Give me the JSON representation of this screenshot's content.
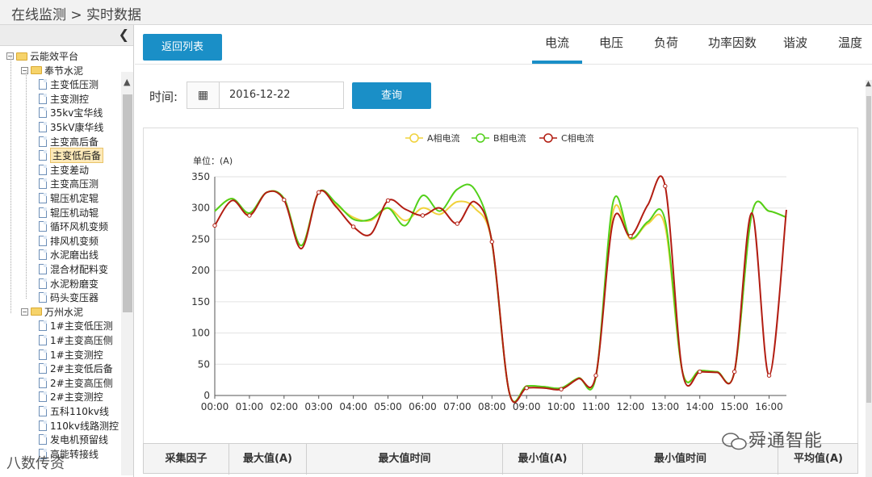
{
  "breadcrumb": "在线监测 > 实时数据",
  "sidebar": {
    "collapse_icon": "chevron-left-icon",
    "tree": [
      {
        "label": "云能效平台",
        "kind": "folder",
        "level": 0,
        "toggle": "⊟"
      },
      {
        "label": "奉节水泥",
        "kind": "folder",
        "level": 1,
        "toggle": "⊟"
      },
      {
        "label": "主变低压测",
        "kind": "doc",
        "level": 2
      },
      {
        "label": "主变测控",
        "kind": "doc",
        "level": 2
      },
      {
        "label": "35kv宝华线",
        "kind": "doc",
        "level": 2
      },
      {
        "label": "35kV康华线",
        "kind": "doc",
        "level": 2
      },
      {
        "label": "主变高后备",
        "kind": "doc",
        "level": 2
      },
      {
        "label": "主变低后备",
        "kind": "doc",
        "level": 2,
        "selected": true
      },
      {
        "label": "主变差动",
        "kind": "doc",
        "level": 2
      },
      {
        "label": "主变高压测",
        "kind": "doc",
        "level": 2
      },
      {
        "label": "辊压机定辊",
        "kind": "doc",
        "level": 2
      },
      {
        "label": "辊压机动辊",
        "kind": "doc",
        "level": 2
      },
      {
        "label": "循环风机变频",
        "kind": "doc",
        "level": 2
      },
      {
        "label": "排风机变频",
        "kind": "doc",
        "level": 2
      },
      {
        "label": "水泥磨出线",
        "kind": "doc",
        "level": 2
      },
      {
        "label": "混合材配料变",
        "kind": "doc",
        "level": 2
      },
      {
        "label": "水泥粉磨变",
        "kind": "doc",
        "level": 2
      },
      {
        "label": "码头变压器",
        "kind": "doc",
        "level": 2
      },
      {
        "label": "万州水泥",
        "kind": "folder",
        "level": 1,
        "toggle": "⊟"
      },
      {
        "label": "1#主变低压测",
        "kind": "doc",
        "level": 2
      },
      {
        "label": "1#主变高压侧",
        "kind": "doc",
        "level": 2
      },
      {
        "label": "1#主变测控",
        "kind": "doc",
        "level": 2
      },
      {
        "label": "2#主变低后备",
        "kind": "doc",
        "level": 2
      },
      {
        "label": "2#主变高压侧",
        "kind": "doc",
        "level": 2
      },
      {
        "label": "2#主变测控",
        "kind": "doc",
        "level": 2
      },
      {
        "label": "五科110kv线",
        "kind": "doc",
        "level": 2
      },
      {
        "label": "110kv线路测控",
        "kind": "doc",
        "level": 2
      },
      {
        "label": "发电机预留线",
        "kind": "doc",
        "level": 2
      },
      {
        "label": "高能转接线",
        "kind": "doc",
        "level": 2
      }
    ]
  },
  "toolbar": {
    "back_label": "返回列表"
  },
  "tabs": [
    "电流",
    "电压",
    "负荷",
    "功率因数",
    "谐波",
    "温度"
  ],
  "active_tab": 0,
  "query": {
    "time_label": "时间:",
    "date_value": "2016-12-22",
    "calendar_icon": "calendar-icon",
    "query_label": "查询"
  },
  "chart_data": {
    "type": "line",
    "unit_label": "单位：(A)",
    "x": [
      "00:00",
      "00:30",
      "01:00",
      "01:30",
      "02:00",
      "02:30",
      "03:00",
      "03:30",
      "04:00",
      "04:30",
      "05:00",
      "05:30",
      "06:00",
      "06:30",
      "07:00",
      "07:30",
      "08:00",
      "08:30",
      "09:00",
      "09:30",
      "10:00",
      "10:30",
      "11:00",
      "11:30",
      "12:00",
      "12:30",
      "13:00",
      "13:30",
      "14:00",
      "14:30",
      "15:00",
      "15:30",
      "16:00",
      "16:30"
    ],
    "x_ticks": [
      "00:00",
      "01:00",
      "02:00",
      "03:00",
      "04:00",
      "05:00",
      "06:00",
      "07:00",
      "08:00",
      "09:00",
      "10:00",
      "11:00",
      "12:00",
      "13:00",
      "14:00",
      "15:00",
      "16:00"
    ],
    "ylim": [
      0,
      350
    ],
    "y_ticks": [
      0,
      50,
      100,
      150,
      200,
      250,
      300,
      350
    ],
    "grid": true,
    "legend_position": "top-center",
    "series": [
      {
        "name": "A相电流",
        "color": "#f0d23c",
        "values": [
          295,
          315,
          290,
          325,
          315,
          240,
          325,
          305,
          285,
          280,
          300,
          280,
          300,
          290,
          310,
          300,
          245,
          5,
          15,
          14,
          12,
          28,
          30,
          295,
          250,
          275,
          270,
          38,
          40,
          38,
          38,
          290,
          295,
          285
        ]
      },
      {
        "name": "B相电流",
        "color": "#52d01a",
        "values": [
          295,
          315,
          292,
          325,
          315,
          240,
          325,
          308,
          282,
          282,
          300,
          272,
          320,
          295,
          330,
          330,
          245,
          5,
          15,
          14,
          12,
          28,
          30,
          310,
          252,
          278,
          280,
          38,
          40,
          38,
          38,
          290,
          295,
          285
        ]
      },
      {
        "name": "C相电流",
        "color": "#b21d12",
        "values": [
          272,
          312,
          288,
          325,
          313,
          235,
          325,
          302,
          270,
          258,
          312,
          298,
          288,
          300,
          275,
          310,
          246,
          5,
          12,
          12,
          10,
          27,
          32,
          280,
          255,
          305,
          335,
          37,
          38,
          37,
          38,
          292,
          32,
          297
        ]
      }
    ]
  },
  "table": {
    "headers": [
      "采集因子",
      "最大值(A)",
      "最大值时间",
      "最小值(A)",
      "最小值时间",
      "平均值(A)"
    ]
  },
  "watermark": "舜通智能",
  "watermark2": "八数传资"
}
